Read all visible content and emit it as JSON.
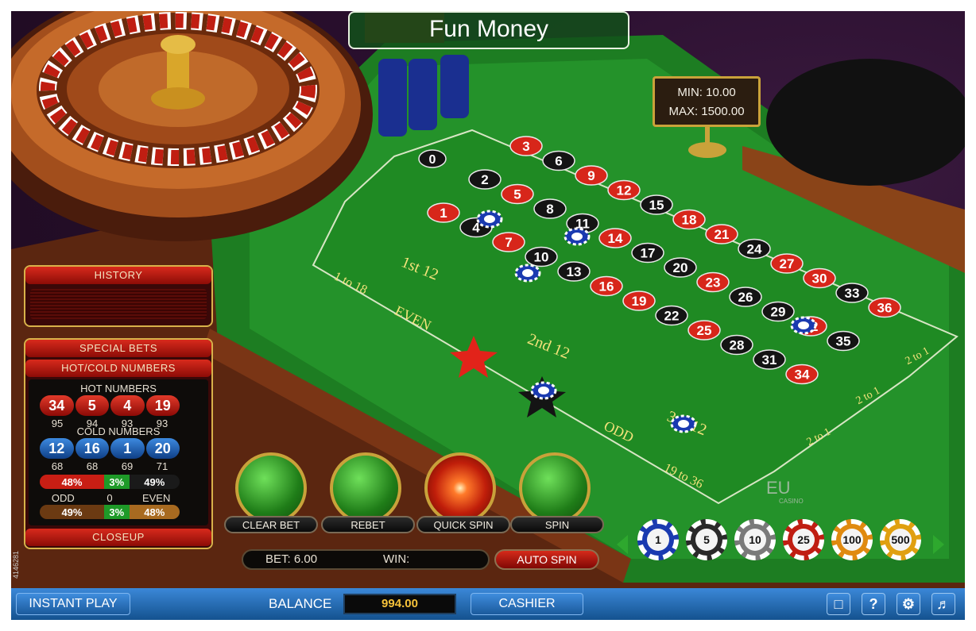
{
  "title": "Fun Money",
  "limits": {
    "min": "MIN: 10.00",
    "max": "MAX: 1500.00"
  },
  "wheel_numbers": [
    "10",
    "5",
    "24",
    "16",
    "33",
    "1",
    "20",
    "14",
    "31",
    "9",
    "22",
    "18",
    "29",
    "7",
    "28",
    "12",
    "35",
    "3",
    "26",
    "0",
    "32",
    "15",
    "19",
    "4",
    "21",
    "2",
    "25",
    "17",
    "34",
    "6",
    "27",
    "13",
    "36",
    "11",
    "30",
    "8",
    "23"
  ],
  "table": {
    "zero": "0",
    "rows": [
      [
        {
          "n": "3",
          "c": "red"
        },
        {
          "n": "6",
          "c": "black"
        },
        {
          "n": "9",
          "c": "red"
        },
        {
          "n": "12",
          "c": "red"
        },
        {
          "n": "15",
          "c": "black"
        },
        {
          "n": "18",
          "c": "red"
        },
        {
          "n": "21",
          "c": "red"
        },
        {
          "n": "24",
          "c": "black"
        },
        {
          "n": "27",
          "c": "red"
        },
        {
          "n": "30",
          "c": "red"
        },
        {
          "n": "33",
          "c": "black"
        },
        {
          "n": "36",
          "c": "red"
        }
      ],
      [
        {
          "n": "2",
          "c": "black"
        },
        {
          "n": "5",
          "c": "red"
        },
        {
          "n": "8",
          "c": "black"
        },
        {
          "n": "11",
          "c": "black"
        },
        {
          "n": "14",
          "c": "red"
        },
        {
          "n": "17",
          "c": "black"
        },
        {
          "n": "20",
          "c": "black"
        },
        {
          "n": "23",
          "c": "red"
        },
        {
          "n": "26",
          "c": "black"
        },
        {
          "n": "29",
          "c": "black"
        },
        {
          "n": "32",
          "c": "red"
        },
        {
          "n": "35",
          "c": "black"
        }
      ],
      [
        {
          "n": "1",
          "c": "red"
        },
        {
          "n": "4",
          "c": "black"
        },
        {
          "n": "7",
          "c": "red"
        },
        {
          "n": "10",
          "c": "black"
        },
        {
          "n": "13",
          "c": "black"
        },
        {
          "n": "16",
          "c": "red"
        },
        {
          "n": "19",
          "c": "red"
        },
        {
          "n": "22",
          "c": "black"
        },
        {
          "n": "25",
          "c": "red"
        },
        {
          "n": "28",
          "c": "black"
        },
        {
          "n": "31",
          "c": "black"
        },
        {
          "n": "34",
          "c": "red"
        }
      ]
    ],
    "dozens": [
      "1st 12",
      "2nd 12",
      "3rd 12"
    ],
    "outside": [
      "1 to 18",
      "EVEN",
      "ODD",
      "19 to 36"
    ],
    "columns": [
      "2 to 1",
      "2 to 1",
      "2 to 1"
    ],
    "brand": "EU",
    "brand_sub": "CASINO"
  },
  "panel": {
    "history_label": "HISTORY",
    "special_bets_label": "SPECIAL BETS",
    "hotcold_label": "HOT/COLD NUMBERS",
    "hot_label": "HOT NUMBERS",
    "hot_numbers": [
      "34",
      "5",
      "4",
      "19"
    ],
    "hot_counts": [
      "95",
      "94",
      "93",
      "93"
    ],
    "cold_label": "COLD NUMBERS",
    "cold_numbers": [
      "12",
      "16",
      "1",
      "20"
    ],
    "cold_counts": [
      "68",
      "68",
      "69",
      "71"
    ],
    "red_pct": "48%",
    "green_pct": "3%",
    "black_pct": "49%",
    "odd_label": "ODD",
    "zero_label": "0",
    "even_label": "EVEN",
    "odd_pct": "49%",
    "zero_pct": "3%",
    "even_pct": "48%",
    "closeup_label": "CLOSEUP"
  },
  "buttons": {
    "clear_bet": "CLEAR BET",
    "rebet": "REBET",
    "quick_spin": "QUICK SPIN",
    "spin": "SPIN"
  },
  "bet": {
    "bet_text": "BET: 6.00",
    "win_text": "WIN:"
  },
  "auto_spin": "AUTO SPIN",
  "chips": [
    "1",
    "5",
    "10",
    "25",
    "100",
    "500"
  ],
  "bottom": {
    "instant_play": "INSTANT PLAY",
    "balance_label": "BALANCE",
    "balance_value": "994.00",
    "cashier": "CASHIER",
    "help_icon_label": "?"
  },
  "side_id": "4146281",
  "colors": {
    "felt": "#1f8a23",
    "red": "#d7261a",
    "black": "#141414",
    "gold": "#c9a23a",
    "bar_blue": "#2872c0"
  }
}
